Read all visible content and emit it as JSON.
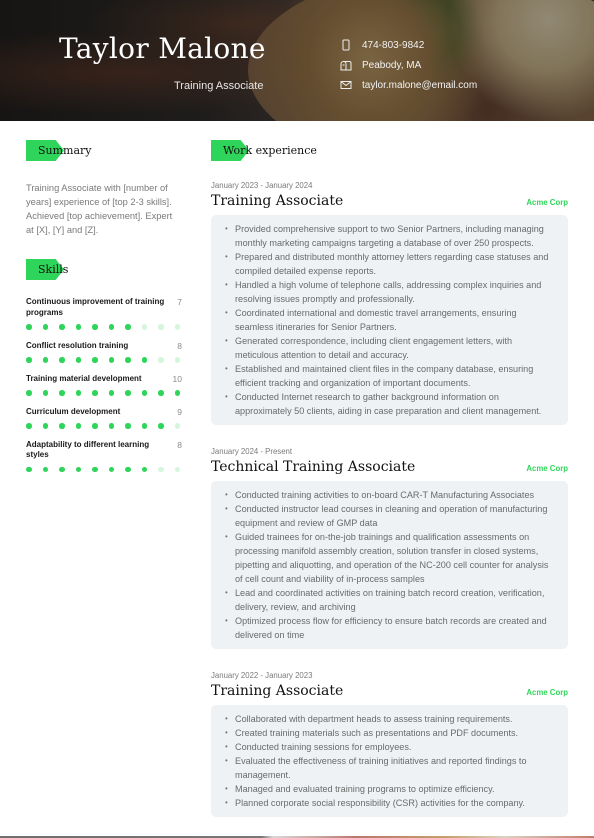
{
  "header": {
    "name": "Taylor Malone",
    "role": "Training Associate",
    "contacts": [
      {
        "icon": "phone-icon",
        "text": "474-803-9842"
      },
      {
        "icon": "mailbox-icon",
        "text": "Peabody, MA"
      },
      {
        "icon": "envelope-icon",
        "text": "taylor.malone@email.com"
      }
    ]
  },
  "colors": {
    "accent": "#2fd55a",
    "box": "#eef2f5"
  },
  "summary": {
    "heading": "Summary",
    "text": "Training Associate with [number of years] experience of [top 2-3 skills]. Achieved [top achievement]. Expert at [X], [Y] and [Z]."
  },
  "skills": {
    "heading": "Skills",
    "max": 10,
    "items": [
      {
        "name": "Continuous improvement of training programs",
        "score": "7",
        "level": 7
      },
      {
        "name": "Conflict resolution training",
        "score": "8",
        "level": 8
      },
      {
        "name": "Training material development",
        "score": "10",
        "level": 10
      },
      {
        "name": "Curriculum development",
        "score": "9",
        "level": 9
      },
      {
        "name": "Adaptability to different learning styles",
        "score": "8",
        "level": 8
      }
    ]
  },
  "work": {
    "heading": "Work experience",
    "jobs": [
      {
        "dates": "January 2023 - January 2024",
        "title": "Training Associate",
        "company": "Acme Corp",
        "bullets": [
          "Provided comprehensive support to two Senior Partners, including managing monthly marketing campaigns targeting a database of over 250 prospects.",
          "Prepared and distributed monthly attorney letters regarding case statuses and compiled detailed expense reports.",
          "Handled a high volume of telephone calls, addressing complex inquiries and resolving issues promptly and professionally.",
          "Coordinated international and domestic travel arrangements, ensuring seamless itineraries for Senior Partners.",
          "Generated correspondence, including client engagement letters, with meticulous attention to detail and accuracy.",
          "Established and maintained client files in the company database, ensuring efficient tracking and organization of important documents.",
          "Conducted Internet research to gather background information on approximately 50 clients, aiding in case preparation and client management."
        ]
      },
      {
        "dates": "January 2024 - Present",
        "title": "Technical Training Associate",
        "company": "Acme Corp",
        "bullets": [
          "Conducted training activities to on-board CAR-T Manufacturing Associates",
          "Conducted instructor lead courses in cleaning and operation of manufacturing equipment and review of GMP data",
          "Guided trainees for on-the-job trainings and qualification assessments on processing manifold assembly creation, solution transfer in closed systems, pipetting and aliquotting, and operation of the NC-200 cell counter for analysis of cell count and viability of in-process samples",
          "Lead and coordinated activities on training batch record creation, verification, delivery, review, and archiving",
          "Optimized process flow for efficiency to ensure batch records are created and delivered on time"
        ]
      },
      {
        "dates": "January 2022 - January 2023",
        "title": "Training Associate",
        "company": "Acme Corp",
        "bullets": [
          "Collaborated with department heads to assess training requirements.",
          "Created training materials such as presentations and PDF documents.",
          "Conducted training sessions for employees.",
          "Evaluated the effectiveness of training initiatives and reported findings to management.",
          "Managed and evaluated training programs to optimize efficiency.",
          "Planned corporate social responsibility (CSR) activities for the company."
        ]
      }
    ]
  }
}
